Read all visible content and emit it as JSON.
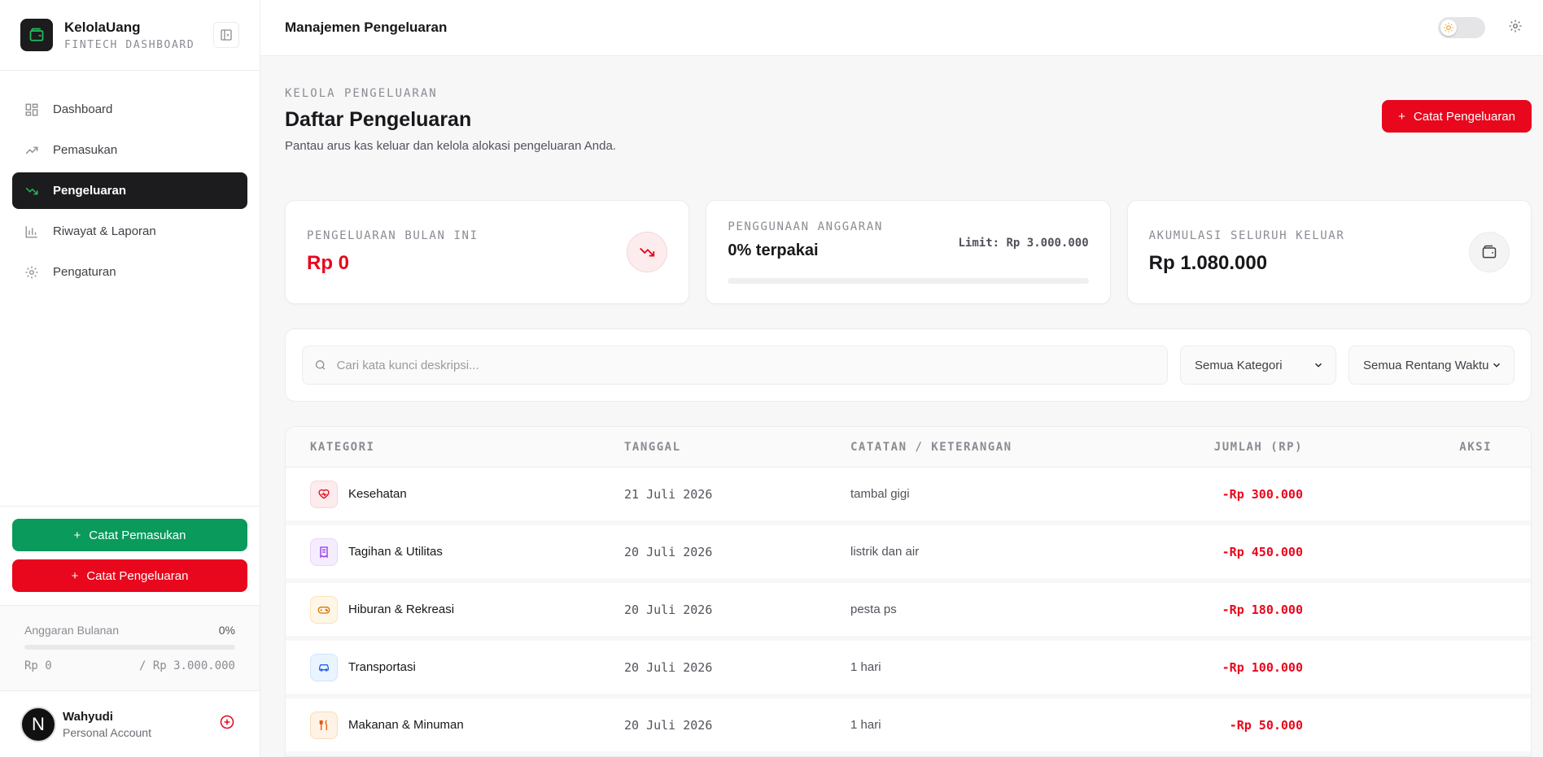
{
  "brand": {
    "name": "KelolaUang",
    "subtitle": "FINTECH DASHBOARD"
  },
  "nav": {
    "items": [
      {
        "label": "Dashboard"
      },
      {
        "label": "Pemasukan"
      },
      {
        "label": "Pengeluaran",
        "active": true
      },
      {
        "label": "Riwayat & Laporan"
      },
      {
        "label": "Pengaturan"
      }
    ]
  },
  "sidebar_actions": {
    "income_label": "Catat Pemasukan",
    "expense_label": "Catat Pengeluaran"
  },
  "budget": {
    "label": "Anggaran Bulanan",
    "percent": "0%",
    "used": "Rp 0",
    "limit": "/ Rp 3.000.000",
    "fill_fraction": 0
  },
  "user": {
    "name": "Wahyudi",
    "role": "Personal Account",
    "initial": "N"
  },
  "topbar": {
    "title": "Manajemen Pengeluaran"
  },
  "page": {
    "eyebrow": "KELOLA PENGELUARAN",
    "title": "Daftar Pengeluaran",
    "subtitle": "Pantau arus kas keluar dan kelola alokasi pengeluaran Anda.",
    "cta_label": "Catat Pengeluaran"
  },
  "cards": {
    "monthly": {
      "label": "PENGELUARAN BULAN INI",
      "value": "Rp 0"
    },
    "budget_use": {
      "label": "PENGGUNAAN ANGGARAN",
      "value": "0% terpakai",
      "limit": "Limit: Rp 3.000.000",
      "fill_fraction": 0
    },
    "total": {
      "label": "AKUMULASI SELURUH KELUAR",
      "value": "Rp 1.080.000"
    }
  },
  "filters": {
    "search_placeholder": "Cari kata kunci deskripsi...",
    "category": "Semua Kategori",
    "range": "Semua Rentang Waktu"
  },
  "table": {
    "headers": {
      "category": "KATEGORI",
      "date": "TANGGAL",
      "note": "CATATAN / KETERANGAN",
      "amount": "JUMLAH (RP)",
      "action": "AKSI"
    },
    "rows": [
      {
        "category": "Kesehatan",
        "date": "21 Juli 2026",
        "note": "tambal gigi",
        "amount": "-Rp 300.000",
        "icon": "heart-pulse-icon"
      },
      {
        "category": "Tagihan & Utilitas",
        "date": "20 Juli 2026",
        "note": "listrik dan air",
        "amount": "-Rp 450.000",
        "icon": "receipt-icon"
      },
      {
        "category": "Hiburan & Rekreasi",
        "date": "20 Juli 2026",
        "note": "pesta ps",
        "amount": "-Rp 180.000",
        "icon": "gamepad-icon"
      },
      {
        "category": "Transportasi",
        "date": "20 Juli 2026",
        "note": "1 hari",
        "amount": "-Rp 100.000",
        "icon": "car-icon"
      },
      {
        "category": "Makanan & Minuman",
        "date": "20 Juli 2026",
        "note": "1 hari",
        "amount": "-Rp 50.000",
        "icon": "utensils-icon"
      }
    ]
  },
  "colors": {
    "accent_red": "#e8071d",
    "accent_green": "#0a9a5c",
    "dark": "#1c1c1f"
  }
}
